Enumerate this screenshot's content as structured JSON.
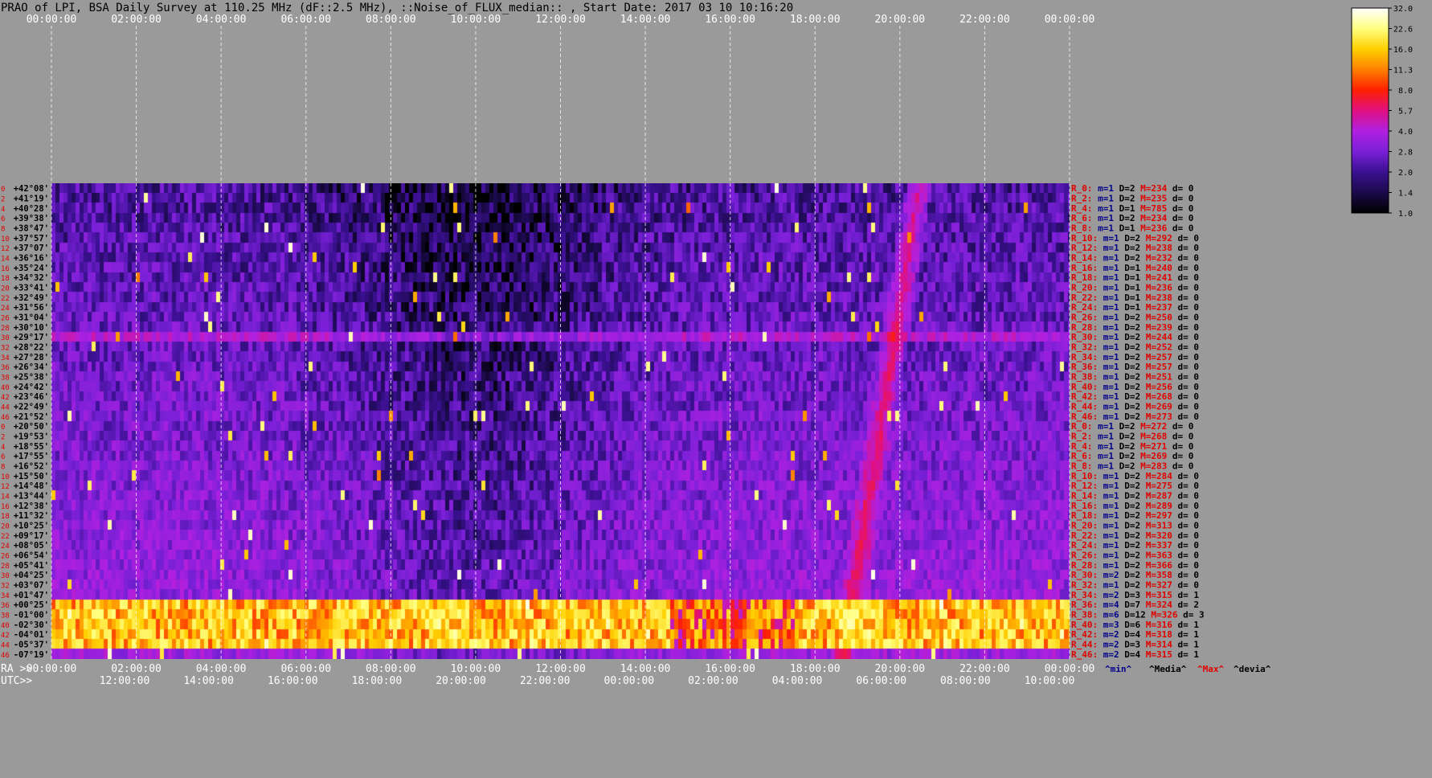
{
  "title": "PRAO of LPI, BSA Daily Survey at 110.25 MHz (dF::2.5 MHz), ::Noise_of_FLUX_median:: , Start Date: 2017 03 10 10:16:20",
  "chart_data": {
    "type": "heatmap",
    "title": "PRAO of LPI, BSA Daily Survey at 110.25 MHz (dF::2.5 MHz), ::Noise_of_FLUX_median:: , Start Date: 2017 03 10 10:16:20",
    "x_axis_top": {
      "ticks": [
        "00:00:00",
        "02:00:00",
        "04:00:00",
        "06:00:00",
        "08:00:00",
        "10:00:00",
        "12:00:00",
        "14:00:00",
        "16:00:00",
        "18:00:00",
        "20:00:00",
        "22:00:00",
        "00:00:00"
      ]
    },
    "x_axis_bottom_ra": {
      "label": "RA >>",
      "ticks": [
        "00:00:00",
        "02:00:00",
        "04:00:00",
        "06:00:00",
        "08:00:00",
        "10:00:00",
        "12:00:00",
        "14:00:00",
        "16:00:00",
        "18:00:00",
        "20:00:00",
        "22:00:00",
        "00:00:00"
      ]
    },
    "x_axis_bottom_utc": {
      "label": "UTC>>",
      "ticks": [
        "12:00:00",
        "14:00:00",
        "16:00:00",
        "18:00:00",
        "20:00:00",
        "22:00:00",
        "00:00:00",
        "02:00:00",
        "04:00:00",
        "06:00:00",
        "08:00:00",
        "10:00:00"
      ]
    },
    "y_axis_declinations": [
      "+42°08'",
      "+41°19'",
      "+40°28'",
      "+39°38'",
      "+38°47'",
      "+37°57'",
      "+37°07'",
      "+36°16'",
      "+35°24'",
      "+34°32'",
      "+33°41'",
      "+32°49'",
      "+31°56'",
      "+31°04'",
      "+30°10'",
      "+29°17'",
      "+28°22'",
      "+27°28'",
      "+26°34'",
      "+25°38'",
      "+24°42'",
      "+23°46'",
      "+22°49'",
      "+21°52'",
      "+20°50'",
      "+19°53'",
      "+18°55'",
      "+17°55'",
      "+16°52'",
      "+15°50'",
      "+14°48'",
      "+13°44'",
      "+12°38'",
      "+11°32'",
      "+10°25'",
      "+09°17'",
      "+08°05'",
      "+06°54'",
      "+05°41'",
      "+04°25'",
      "+03°07'",
      "+01°47'",
      "+00°25'",
      "-01°00'",
      "-02°30'",
      "-04°01'",
      "-05°37'",
      "-07°19'"
    ],
    "y_axis_row_indices": [
      "0",
      "2",
      "4",
      "6",
      "8",
      "10",
      "12",
      "14",
      "16",
      "18",
      "20",
      "22",
      "24",
      "26",
      "28",
      "30",
      "32",
      "34",
      "36",
      "38",
      "40",
      "42",
      "44",
      "46",
      "0",
      "2",
      "4",
      "6",
      "8",
      "10",
      "12",
      "14",
      "16",
      "18",
      "20",
      "22",
      "24",
      "26",
      "28",
      "30",
      "32",
      "34",
      "36",
      "38",
      "40",
      "42",
      "44",
      "46"
    ],
    "row_stats": [
      {
        "R": "R_0:",
        "m": "m=1",
        "D": "D=2",
        "M": "M=234",
        "d": "d= 0"
      },
      {
        "R": "R_2:",
        "m": "m=1",
        "D": "D=2",
        "M": "M=235",
        "d": "d= 0"
      },
      {
        "R": "R_4:",
        "m": "m=1",
        "D": "D=1",
        "M": "M=785",
        "d": "d= 0"
      },
      {
        "R": "R_6:",
        "m": "m=1",
        "D": "D=2",
        "M": "M=234",
        "d": "d= 0"
      },
      {
        "R": "R_8:",
        "m": "m=1",
        "D": "D=1",
        "M": "M=236",
        "d": "d= 0"
      },
      {
        "R": "R_10:",
        "m": "m=1",
        "D": "D=2",
        "M": "M=292",
        "d": "d= 0"
      },
      {
        "R": "R_12:",
        "m": "m=1",
        "D": "D=2",
        "M": "M=238",
        "d": "d= 0"
      },
      {
        "R": "R_14:",
        "m": "m=1",
        "D": "D=2",
        "M": "M=232",
        "d": "d= 0"
      },
      {
        "R": "R_16:",
        "m": "m=1",
        "D": "D=1",
        "M": "M=240",
        "d": "d= 0"
      },
      {
        "R": "R_18:",
        "m": "m=1",
        "D": "D=1",
        "M": "M=241",
        "d": "d= 0"
      },
      {
        "R": "R_20:",
        "m": "m=1",
        "D": "D=1",
        "M": "M=236",
        "d": "d= 0"
      },
      {
        "R": "R_22:",
        "m": "m=1",
        "D": "D=1",
        "M": "M=238",
        "d": "d= 0"
      },
      {
        "R": "R_24:",
        "m": "m=1",
        "D": "D=1",
        "M": "M=237",
        "d": "d= 0"
      },
      {
        "R": "R_26:",
        "m": "m=1",
        "D": "D=2",
        "M": "M=250",
        "d": "d= 0"
      },
      {
        "R": "R_28:",
        "m": "m=1",
        "D": "D=2",
        "M": "M=239",
        "d": "d= 0"
      },
      {
        "R": "R_30:",
        "m": "m=1",
        "D": "D=2",
        "M": "M=244",
        "d": "d= 0"
      },
      {
        "R": "R_32:",
        "m": "m=1",
        "D": "D=2",
        "M": "M=252",
        "d": "d= 0"
      },
      {
        "R": "R_34:",
        "m": "m=1",
        "D": "D=2",
        "M": "M=257",
        "d": "d= 0"
      },
      {
        "R": "R_36:",
        "m": "m=1",
        "D": "D=2",
        "M": "M=257",
        "d": "d= 0"
      },
      {
        "R": "R_38:",
        "m": "m=1",
        "D": "D=2",
        "M": "M=251",
        "d": "d= 0"
      },
      {
        "R": "R_40:",
        "m": "m=1",
        "D": "D=2",
        "M": "M=256",
        "d": "d= 0"
      },
      {
        "R": "R_42:",
        "m": "m=1",
        "D": "D=2",
        "M": "M=268",
        "d": "d= 0"
      },
      {
        "R": "R_44:",
        "m": "m=1",
        "D": "D=2",
        "M": "M=269",
        "d": "d= 0"
      },
      {
        "R": "R_46:",
        "m": "m=1",
        "D": "D=2",
        "M": "M=273",
        "d": "d= 0"
      },
      {
        "R": "R_0:",
        "m": "m=1",
        "D": "D=2",
        "M": "M=272",
        "d": "d= 0"
      },
      {
        "R": "R_2:",
        "m": "m=1",
        "D": "D=2",
        "M": "M=268",
        "d": "d= 0"
      },
      {
        "R": "R_4:",
        "m": "m=1",
        "D": "D=2",
        "M": "M=271",
        "d": "d= 0"
      },
      {
        "R": "R_6:",
        "m": "m=1",
        "D": "D=2",
        "M": "M=269",
        "d": "d= 0"
      },
      {
        "R": "R_8:",
        "m": "m=1",
        "D": "D=2",
        "M": "M=283",
        "d": "d= 0"
      },
      {
        "R": "R_10:",
        "m": "m=1",
        "D": "D=2",
        "M": "M=284",
        "d": "d= 0"
      },
      {
        "R": "R_12:",
        "m": "m=1",
        "D": "D=2",
        "M": "M=275",
        "d": "d= 0"
      },
      {
        "R": "R_14:",
        "m": "m=1",
        "D": "D=2",
        "M": "M=287",
        "d": "d= 0"
      },
      {
        "R": "R_16:",
        "m": "m=1",
        "D": "D=2",
        "M": "M=289",
        "d": "d= 0"
      },
      {
        "R": "R_18:",
        "m": "m=1",
        "D": "D=2",
        "M": "M=297",
        "d": "d= 0"
      },
      {
        "R": "R_20:",
        "m": "m=1",
        "D": "D=2",
        "M": "M=313",
        "d": "d= 0"
      },
      {
        "R": "R_22:",
        "m": "m=1",
        "D": "D=2",
        "M": "M=320",
        "d": "d= 0"
      },
      {
        "R": "R_24:",
        "m": "m=1",
        "D": "D=2",
        "M": "M=337",
        "d": "d= 0"
      },
      {
        "R": "R_26:",
        "m": "m=1",
        "D": "D=2",
        "M": "M=363",
        "d": "d= 0"
      },
      {
        "R": "R_28:",
        "m": "m=1",
        "D": "D=2",
        "M": "M=366",
        "d": "d= 0"
      },
      {
        "R": "R_30:",
        "m": "m=2",
        "D": "D=2",
        "M": "M=358",
        "d": "d= 0"
      },
      {
        "R": "R_32:",
        "m": "m=1",
        "D": "D=2",
        "M": "M=327",
        "d": "d= 0"
      },
      {
        "R": "R_34:",
        "m": "m=2",
        "D": "D=3",
        "M": "M=315",
        "d": "d= 1"
      },
      {
        "R": "R_36:",
        "m": "m=4",
        "D": "D=7",
        "M": "M=324",
        "d": "d= 2"
      },
      {
        "R": "R_38:",
        "m": "m=6",
        "D": "D=12",
        "M": "M=326",
        "d": "d= 3"
      },
      {
        "R": "R_40:",
        "m": "m=3",
        "D": "D=6",
        "M": "M=316",
        "d": "d= 1"
      },
      {
        "R": "R_42:",
        "m": "m=2",
        "D": "D=4",
        "M": "M=318",
        "d": "d= 1"
      },
      {
        "R": "R_44:",
        "m": "m=2",
        "D": "D=3",
        "M": "M=314",
        "d": "d= 1"
      },
      {
        "R": "R_46:",
        "m": "m=2",
        "D": "D=4",
        "M": "M=315",
        "d": "d= 1"
      }
    ],
    "stats_legend": [
      "^min^",
      "^Media^",
      "^Max^",
      "^devia^"
    ],
    "colorbar": {
      "ticks": [
        "32.0",
        "22.6",
        "16.0",
        "11.3",
        "8.0",
        "5.7",
        "4.0",
        "2.8",
        "2.0",
        "1.4",
        "1.0"
      ],
      "scale": "log",
      "range": [
        1.0,
        32.0
      ],
      "colors": [
        "#000000",
        "#1a0a4a",
        "#3a1090",
        "#7a20d8",
        "#b020e0",
        "#e01080",
        "#ff2000",
        "#ff8000",
        "#ffd000",
        "#ffff80",
        "#ffffff"
      ]
    },
    "colors": {
      "background": "#9a9a9a",
      "stat_R": "#e00000",
      "stat_m": "#00008b",
      "stat_D": "#000000",
      "stat_M": "#e00000",
      "stat_d": "#000000",
      "legend_min": "#00008b",
      "legend_media": "#000000",
      "legend_max": "#e00000",
      "legend_devia": "#000000"
    }
  }
}
